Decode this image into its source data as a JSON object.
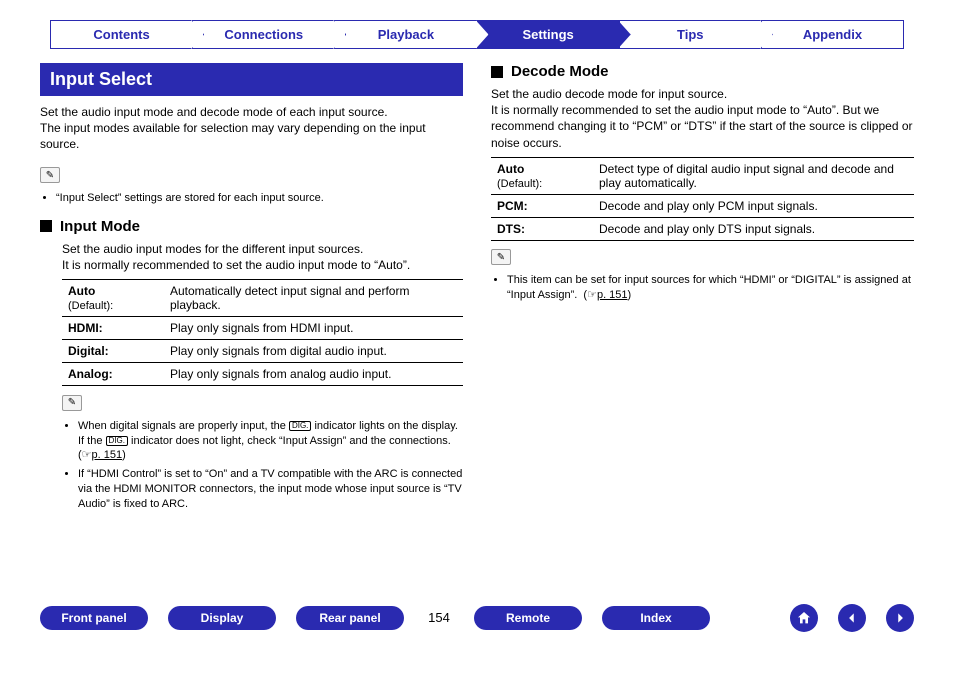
{
  "tabs": [
    "Contents",
    "Connections",
    "Playback",
    "Settings",
    "Tips",
    "Appendix"
  ],
  "activeTab": 3,
  "left": {
    "sectionTitle": "Input Select",
    "intro": "Set the audio input mode and decode mode of each input source.\nThe input modes available for selection may vary depending on the input source.",
    "note1": [
      "“Input Select” settings are stored for each input source."
    ],
    "sub": "Input Mode",
    "subIntro": "Set the audio input modes for the different input sources.\nIt is normally recommended to set the audio input mode to “Auto”.",
    "rows": [
      {
        "key": "Auto",
        "default": "(Default):",
        "val": "Automatically detect input signal and perform playback."
      },
      {
        "key": "HDMI:",
        "val": "Play only signals from HDMI input."
      },
      {
        "key": "Digital:",
        "val": "Play only signals from digital audio input."
      },
      {
        "key": "Analog:",
        "val": "Play only signals from analog audio input."
      }
    ],
    "note2": [
      "When digital signals are properly input, the [DIG] indicator lights on the display. If the [DIG] indicator does not light, check “Input Assign” and the connections. (☞ p. 151)",
      "If “HDMI Control” is set to “On” and a TV compatible with the ARC is connected via the HDMI MONITOR connectors, the input mode whose input source is “TV Audio” is fixed to ARC."
    ],
    "pageRef": "p. 151"
  },
  "right": {
    "sub": "Decode Mode",
    "subIntro": "Set the audio decode mode for input source.\nIt is normally recommended to set the audio input mode to “Auto”. But we recommend changing it to “PCM” or “DTS” if the start of the source is clipped or noise occurs.",
    "rows": [
      {
        "key": "Auto",
        "default": "(Default):",
        "val": "Detect type of digital audio input signal and decode and play automatically."
      },
      {
        "key": "PCM:",
        "val": "Decode and play only PCM input signals."
      },
      {
        "key": "DTS:",
        "val": "Decode and play only DTS input signals."
      }
    ],
    "note": [
      "This item can be set for input sources for which “HDMI” or “DIGITAL” is assigned at “Input Assign”.  (☞ p. 151)"
    ],
    "pageRef": "p. 151"
  },
  "footer": {
    "buttons": [
      "Front panel",
      "Display",
      "Rear panel"
    ],
    "page": "154",
    "buttons2": [
      "Remote",
      "Index"
    ]
  }
}
